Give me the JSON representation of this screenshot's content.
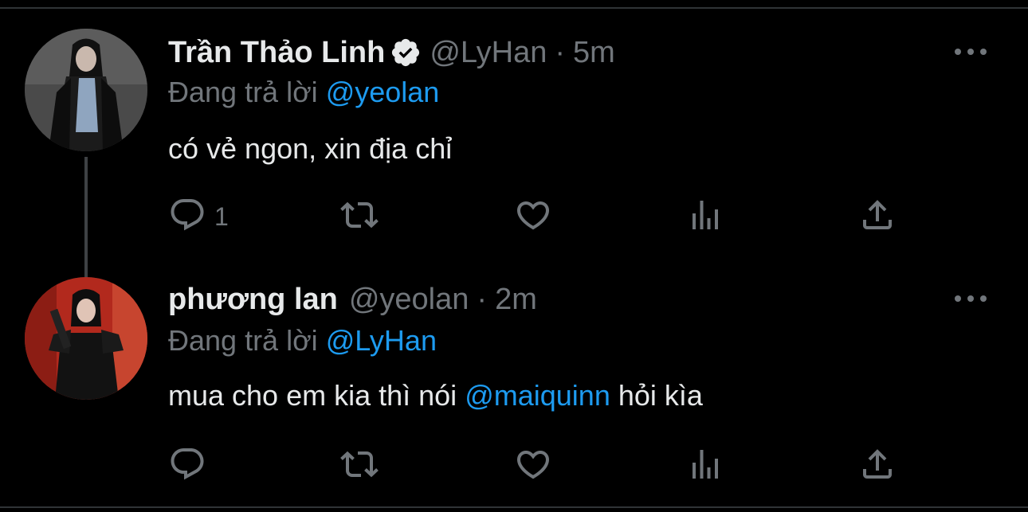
{
  "tweets": [
    {
      "name": "Trần Thảo Linh",
      "verified": true,
      "handle": "@LyHan",
      "separator": "·",
      "time": "5m",
      "replying_prefix": "Đang trả lời",
      "replying_to": "@yeolan",
      "text": "có vẻ ngon, xin địa chỉ",
      "reply_count": "1"
    },
    {
      "name": "phương lan",
      "verified": false,
      "handle": "@yeolan",
      "separator": "·",
      "time": "2m",
      "replying_prefix": "Đang trả lời",
      "replying_to": "@LyHan",
      "text_before": "mua cho em kia thì nói",
      "text_mention": "@maiquinn",
      "text_after": "hỏi kìa",
      "reply_count": ""
    }
  ],
  "icons": {
    "more": "more-horizontal-icon",
    "reply": "reply-icon",
    "retweet": "retweet-icon",
    "like": "heart-icon",
    "views": "analytics-icon",
    "share": "share-icon",
    "verified": "verified-badge-icon"
  },
  "colors": {
    "background": "#000000",
    "text": "#e7e9ea",
    "muted": "#71767b",
    "accent": "#1d9bf0",
    "divider": "#2f3336"
  }
}
